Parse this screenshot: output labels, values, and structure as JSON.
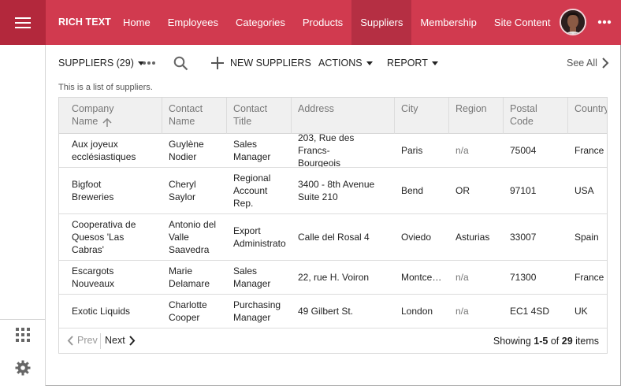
{
  "app": {
    "brand": "RICH TEXT",
    "nav": [
      {
        "label": "Home"
      },
      {
        "label": "Employees"
      },
      {
        "label": "Categories"
      },
      {
        "label": "Products"
      },
      {
        "label": "Suppliers",
        "active": true
      },
      {
        "label": "Membership"
      },
      {
        "label": "Site Content"
      }
    ],
    "colors": {
      "topbar": "#d13a4f",
      "hamburger_bg": "#b3283c",
      "active_tab": "#b52f43"
    }
  },
  "toolbar": {
    "view_label": "SUPPLIERS (29)",
    "new_label": "NEW SUPPLIERS",
    "actions_label": "ACTIONS",
    "report_label": "REPORT",
    "see_all_label": "See All"
  },
  "description": "This is a list of suppliers.",
  "grid": {
    "columns": [
      "Company\nName",
      "Contact\nName",
      "Contact\nTitle",
      "Address",
      "City",
      "Region",
      "Postal Code",
      "Country"
    ],
    "sorted_column": "Company Name",
    "sort_direction": "ascending",
    "rows": [
      [
        "Aux joyeux\necclésiastiques",
        "Guylène\nNodier",
        "Sales\nManager",
        "203, Rue des Francs-\nBourgeois",
        "Paris",
        "n/a",
        "75004",
        "France"
      ],
      [
        "Bigfoot\nBreweries",
        "Cheryl\nSaylor",
        "Regional\nAccount\nRep.",
        "3400 - 8th Avenue\nSuite 210",
        "Bend",
        "OR",
        "97101",
        "USA"
      ],
      [
        "Cooperativa de\nQuesos 'Las\nCabras'",
        "Antonio del\nValle\nSaavedra",
        "Export\nAdministrato",
        "Calle del Rosal 4",
        "Oviedo",
        "Asturias",
        "33007",
        "Spain"
      ],
      [
        "Escargots\nNouveaux",
        "Marie\nDelamare",
        "Sales\nManager",
        "22, rue H. Voiron",
        "Montce…",
        "n/a",
        "71300",
        "France"
      ],
      [
        "Exotic Liquids",
        "Charlotte\nCooper",
        "Purchasing\nManager",
        "49 Gilbert St.",
        "London",
        "n/a",
        "EC1 4SD",
        "UK"
      ]
    ]
  },
  "pager": {
    "prev_label": "Prev",
    "next_label": "Next",
    "showing_prefix": "Showing ",
    "range": "1-5",
    "of_text": " of ",
    "total": "29",
    "suffix": " items"
  }
}
